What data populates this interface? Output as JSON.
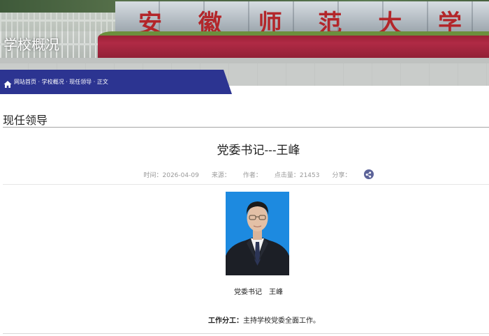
{
  "banner": {
    "title": "学校概况",
    "carving": [
      "安",
      "徽",
      "师",
      "范",
      "大",
      "学"
    ]
  },
  "breadcrumb": {
    "text": "网站首页 · 学校概况 · 现任领导 · 正文",
    "icon": "home-icon"
  },
  "section": {
    "title": "现任领导"
  },
  "article": {
    "title": "党委书记---王峰",
    "meta": {
      "time_label": "时间：",
      "time_value": "2026-04-09",
      "source_label": "来源：",
      "author_label": "作者：",
      "views_label": "点击量：",
      "views_value": "21453",
      "share_label": "分享："
    },
    "photo_caption": "党委书记　王峰",
    "duty_label": "工作分工：",
    "duty_text": "主持学校党委全面工作。"
  },
  "colors": {
    "breadcrumb_bg": "#2c3491",
    "photo_bg": "#1d8ae0",
    "share_icon": "#5c6399",
    "carving": "#b3262a"
  }
}
